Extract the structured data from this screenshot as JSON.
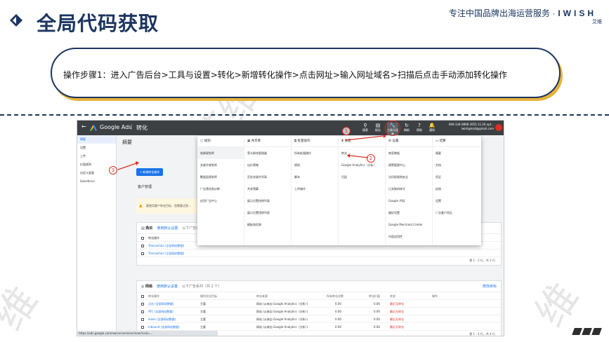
{
  "header": {
    "title": "全局代码获取",
    "brand_prefix": "专注中国品牌出海运营服务 ·",
    "brand_name": "IWISH",
    "brand_sub": "艾维"
  },
  "steps": {
    "text": "操作步骤1：进入广告后台>工具与设置>转化>新增转化操作>点击网址>输入网址域名>扫描后点击手动添加转化操作"
  },
  "watermark": [
    "维",
    "深圳艾维",
    "深圳艾维",
    "维"
  ],
  "screenshot": {
    "topbar": {
      "back": "←",
      "product": "Google Ads",
      "separator": "|",
      "page": "转化",
      "icons": [
        {
          "name": "search-icon",
          "glyph": "⚲",
          "label": "搜索"
        },
        {
          "name": "reports-icon",
          "glyph": "▤",
          "label": "报告"
        },
        {
          "name": "tools-icon",
          "glyph": "🔧",
          "label": "工具与设置"
        },
        {
          "name": "refresh-icon",
          "glyph": "↻",
          "label": "刷新"
        },
        {
          "name": "help-icon",
          "glyph": "?",
          "label": "帮助"
        },
        {
          "name": "notifications-icon",
          "glyph": "🔔",
          "label": "通知"
        }
      ],
      "account_line1": "094-334-0898 2055.11.20 opt...",
      "account_line2": "iwishgmail@gmail.com"
    },
    "sidebar": [
      "摘要",
      "设置",
      "上传",
      "价值规则",
      "自定义变量",
      "Salesforce"
    ],
    "summary_title": "摘要",
    "new_action_button": "+ 新增转化操作",
    "account_manager": "客户管理",
    "warning": "要使用客户转化目标，您需要达到...",
    "card1": {
      "title": "购买",
      "link": "使用默认设置",
      "link2": "以下广告系列",
      "header_col": "转化操作",
      "rows": [
        "Transaction (全部网站数据)",
        "Transaction (全部网站数据)"
      ],
      "pager": "第 1 - 2 行，共 2 行"
    },
    "card2": {
      "title": "网络",
      "link": "使用默认设置",
      "link2": "以下广告系列（共 2 个）",
      "edit_goal": "修改目标",
      "columns": [
        "转化操作",
        "操作优化目标",
        "转化来源",
        "所有转化次数",
        "转化价值",
        "状态",
        "操作"
      ],
      "rows": [
        {
          "name": "点击 (全部网站数据)",
          "goal": "主要",
          "source": "网站 (从来自 Google Analytics（分析）)",
          "conv": "0.00",
          "value": "0.00",
          "status": "最近无转化"
        },
        {
          "name": "ATC (全部网站数据)",
          "goal": "主要",
          "source": "网站 (从来自 Google Analytics（分析）)",
          "conv": "0.00",
          "value": "0.00",
          "status": "最近无转化"
        },
        {
          "name": "leads (全部网站数据)",
          "goal": "主要",
          "source": "网站 (从来自 Google Analytics（分析）)",
          "conv": "0.00",
          "value": "0.00",
          "status": "最近无转化"
        },
        {
          "name": "Inbound (全部网站数据)",
          "goal": "主要",
          "source": "网站 (从来自 Google Analytics（分析）)",
          "conv": "0.00",
          "value": "0.00",
          "status": "最近无转化"
        }
      ],
      "pager": "第 1 - 4 行，共 4 行"
    },
    "tools_menu": [
      {
        "title": "规划",
        "items": [
          "效果规划师",
          "关键字规划师",
          "覆盖面规划师",
          "广告预览和诊断",
          "应用广告中心"
        ]
      },
      {
        "title": "共享库",
        "items": [
          "受众群体管理器",
          "出价策略",
          "否定关键字列表",
          "共享预算",
          "展示位置排除列表",
          "展示位置排除列表",
          "模板和资源"
        ]
      },
      {
        "title": "批量操作",
        "items": [
          "所有批量操作",
          "规则",
          "脚本",
          "上传操作"
        ]
      },
      {
        "title": "衡量",
        "items": [
          "转化",
          "Google Analytics（分析）",
          "归因"
        ]
      },
      {
        "title": "设置",
        "items": [
          "商家数据",
          "政策管理中心",
          "访问权限和安全",
          "已关联的帐号",
          "Google 代码",
          "偏好设置",
          "Google Merchant Center",
          "内容适用性"
        ]
      },
      {
        "title": "结算",
        "items": [
          "摘要",
          "文档",
          "凭证",
          "促销",
          "设置",
          "广告客户验证"
        ]
      }
    ],
    "status_url": "https://ads.google.com/aw/conversions/new?ocid=...",
    "annotations": [
      "1",
      "2",
      "3"
    ]
  }
}
